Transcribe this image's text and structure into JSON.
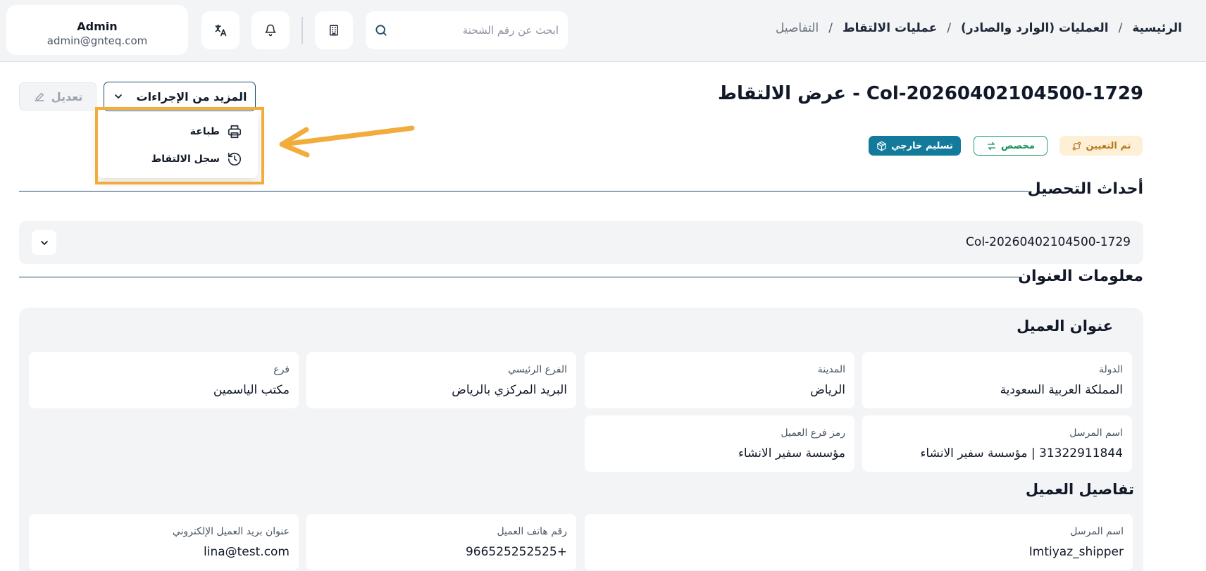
{
  "topbar": {
    "user": {
      "name": "Admin",
      "email": "admin@gnteq.com"
    },
    "search": {
      "placeholder": "ابحث عن رقم الشحنة",
      "value": ""
    },
    "breadcrumb": {
      "home": "الرئيسية",
      "operations": "العمليات (الوارد والصادر)",
      "pickups": "عمليات الالتقاط",
      "current": "التفاصيل",
      "separator": "/"
    },
    "icons": [
      "translate-icon",
      "bell-icon",
      "building-icon",
      "search-icon"
    ]
  },
  "header": {
    "title": "عرض الالتقاط - Col-20260402104500-1729",
    "edit_label": "تعديل",
    "more_actions_label": "المزيد من الإجراءات"
  },
  "dropdown": {
    "print_label": "طباعة",
    "history_label": "سجل الالتقاط"
  },
  "badges": {
    "assigned": "تم التعيين",
    "custom": "مخصص",
    "external": "تسليم خارجي"
  },
  "events": {
    "title": "أحداث التحصيل",
    "code": "Col-20260402104500-1729"
  },
  "address": {
    "title": "معلومات العنوان",
    "customer_address_title": "عنوان العميل",
    "fields": {
      "country_label": "الدولة",
      "country_value": "المملكة العربية السعودية",
      "city_label": "المدينة",
      "city_value": "الرياض",
      "main_branch_label": "الفرع الرئيسي",
      "main_branch_value": "البريد المركزي بالرياض",
      "branch_label": "فرع",
      "branch_value": "مكتب الياسمين",
      "sender_label": "اسم المرسل",
      "sender_value": "31322911844 | مؤسسة سفير الانشاء",
      "customer_branch_code_label": "رمز فرع العميل",
      "customer_branch_code_value": "مؤسسة سفير الانشاء"
    },
    "customer_details_title": "تفاصيل العميل",
    "details": {
      "sender_label": "اسم المرسل",
      "sender_value": "Imtiyaz_shipper",
      "phone_label": "رقم هاتف العميل",
      "phone_value": "966525252525+",
      "email_label": "عنوان بريد العميل الإلكتروني",
      "email_value": "lina@test.com"
    }
  },
  "colors": {
    "primary": "#1f4e6b",
    "annotation": "#f2ac3c",
    "badge_external": "#137a9c",
    "badge_custom": "#22a06b",
    "badge_assigned": "#b7791f"
  }
}
